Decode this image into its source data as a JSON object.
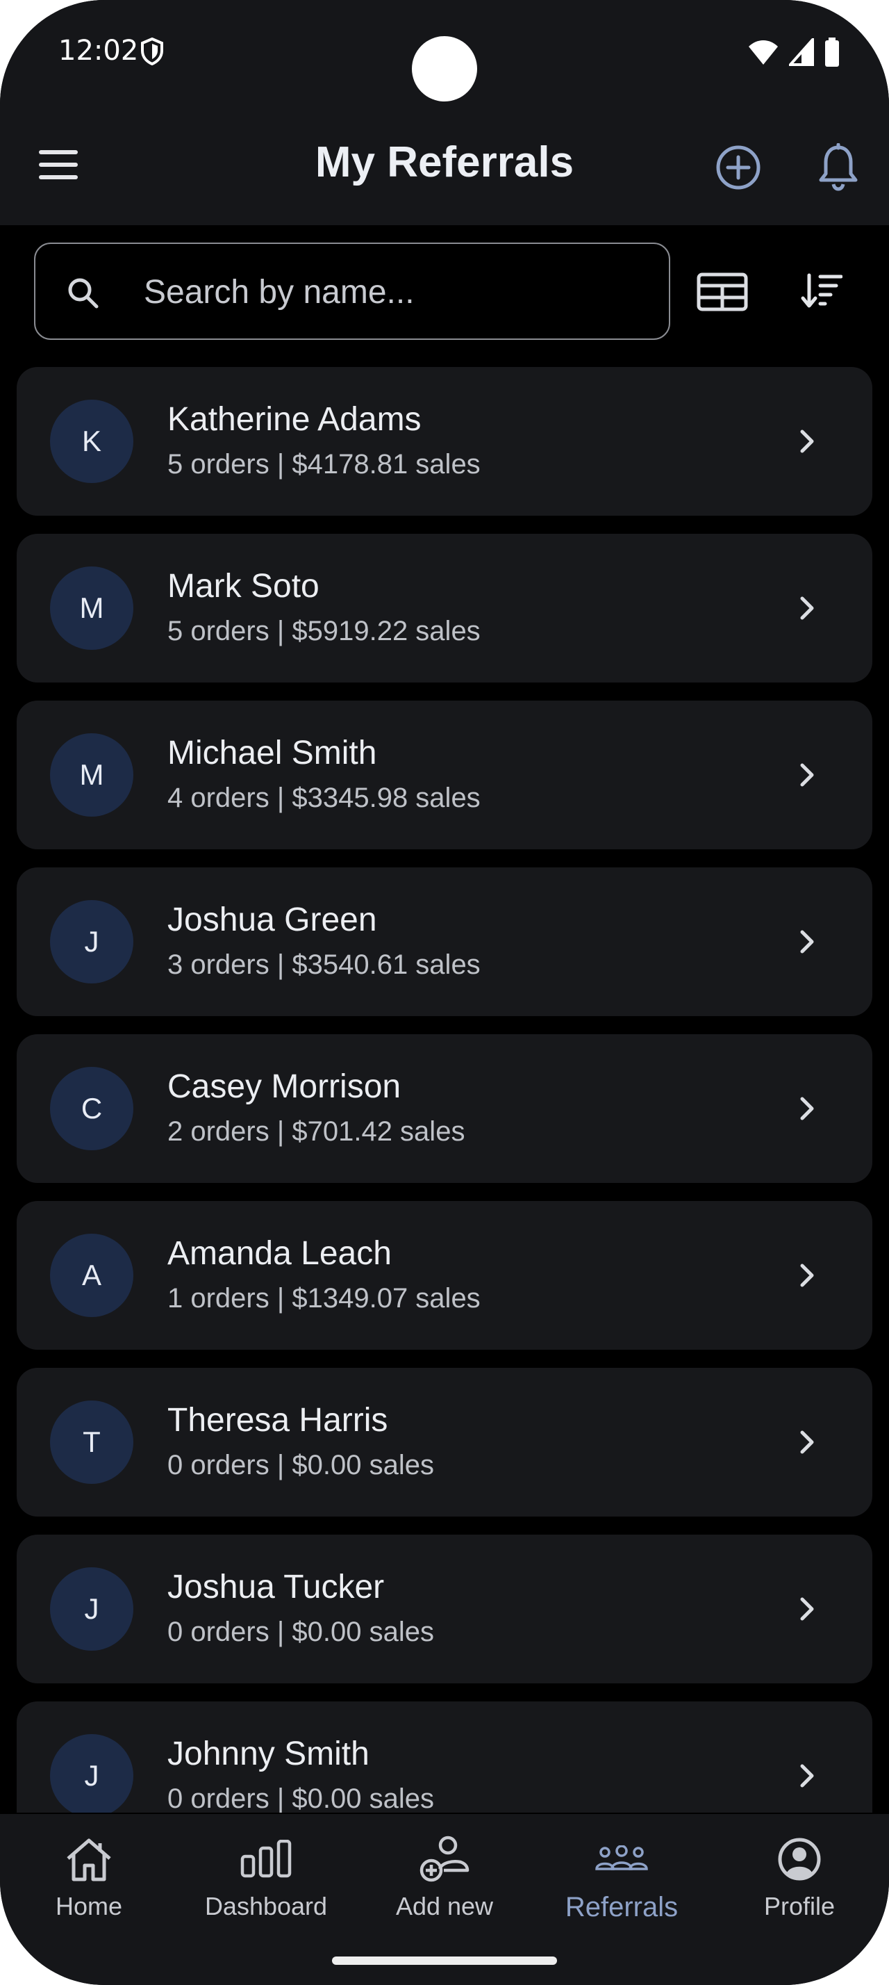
{
  "status_bar": {
    "time": "12:02"
  },
  "app_bar": {
    "title": "My Referrals",
    "menu_icon": "hamburger-menu-icon",
    "add_icon": "add-circle-icon",
    "bell_icon": "bell-icon"
  },
  "search": {
    "placeholder": "Search by name...",
    "value": ""
  },
  "toolbar": {
    "table_icon": "table-view-icon",
    "sort_icon": "sort-icon"
  },
  "accent_color": "#8ea2c8",
  "referrals": [
    {
      "initial": "K",
      "name": "Katherine Adams",
      "stats": "5 orders | $4178.81 sales"
    },
    {
      "initial": "M",
      "name": "Mark Soto",
      "stats": "5 orders | $5919.22 sales"
    },
    {
      "initial": "M",
      "name": "Michael Smith",
      "stats": "4 orders | $3345.98 sales"
    },
    {
      "initial": "J",
      "name": "Joshua Green",
      "stats": "3 orders | $3540.61 sales"
    },
    {
      "initial": "C",
      "name": "Casey Morrison",
      "stats": "2 orders | $701.42 sales"
    },
    {
      "initial": "A",
      "name": "Amanda Leach",
      "stats": "1 orders | $1349.07 sales"
    },
    {
      "initial": "T",
      "name": "Theresa Harris",
      "stats": "0 orders | $0.00 sales"
    },
    {
      "initial": "J",
      "name": "Joshua Tucker",
      "stats": "0 orders | $0.00 sales"
    },
    {
      "initial": "J",
      "name": "Johnny Smith",
      "stats": "0 orders | $0.00 sales"
    }
  ],
  "bottom_nav": {
    "items": [
      {
        "label": "Home",
        "icon": "home-icon"
      },
      {
        "label": "Dashboard",
        "icon": "bar-chart-icon"
      },
      {
        "label": "Add new",
        "icon": "add-person-icon"
      },
      {
        "label": "Referrals",
        "icon": "group-icon",
        "active": true
      },
      {
        "label": "Profile",
        "icon": "account-circle-icon"
      }
    ]
  }
}
